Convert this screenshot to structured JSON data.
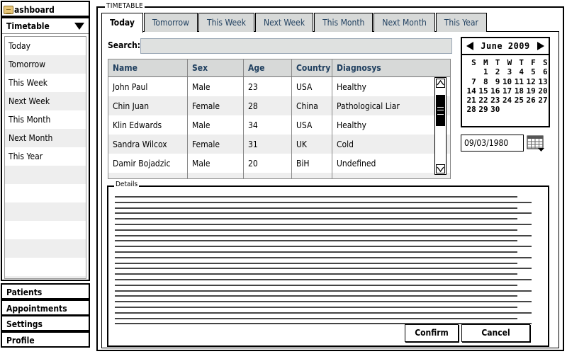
{
  "sidebar": {
    "dashboard_label": "ashboard",
    "timetable_label": "Timetable",
    "timetable_items": [
      "Today",
      "Tomorrow",
      "This Week",
      "Next Week",
      "This Month",
      "Next Month",
      "This Year"
    ],
    "patients_label": "Patients",
    "appointments_label": "Appointments",
    "settings_label": "Settings",
    "profile_label": "Profile"
  },
  "frame_title": "TIMETABLE",
  "tabs": [
    "Today",
    "Tomorrow",
    "This Week",
    "Next Week",
    "This Month",
    "Next Month",
    "This Year"
  ],
  "active_tab": "Today",
  "search": {
    "label": "Search:",
    "value": ""
  },
  "grid": {
    "columns": [
      "Name",
      "Sex",
      "Age",
      "Country",
      "Diagnosys"
    ],
    "rows": [
      [
        "John Paul",
        "Male",
        "23",
        "USA",
        "Healthy"
      ],
      [
        "Chin Juan",
        "Female",
        "28",
        "China",
        "Pathological Liar"
      ],
      [
        "Klin Edwards",
        "Male",
        "34",
        "USA",
        "Healthy"
      ],
      [
        "Sandra Wilcox",
        "Female",
        "31",
        "UK",
        "Cold"
      ],
      [
        "Damir Bojadzic",
        "Male",
        "20",
        "BiH",
        "Undefined"
      ]
    ]
  },
  "calendar": {
    "month_label": "June 2009",
    "weekdays": [
      "S",
      "M",
      "T",
      "W",
      "T",
      "F",
      "S"
    ],
    "first_weekday_index": 1,
    "days_in_month": 30
  },
  "date_input": {
    "value": "09/03/1980"
  },
  "details": {
    "label": "Details",
    "line_count": 24
  },
  "buttons": {
    "confirm": "Confirm",
    "cancel": "Cancel"
  }
}
